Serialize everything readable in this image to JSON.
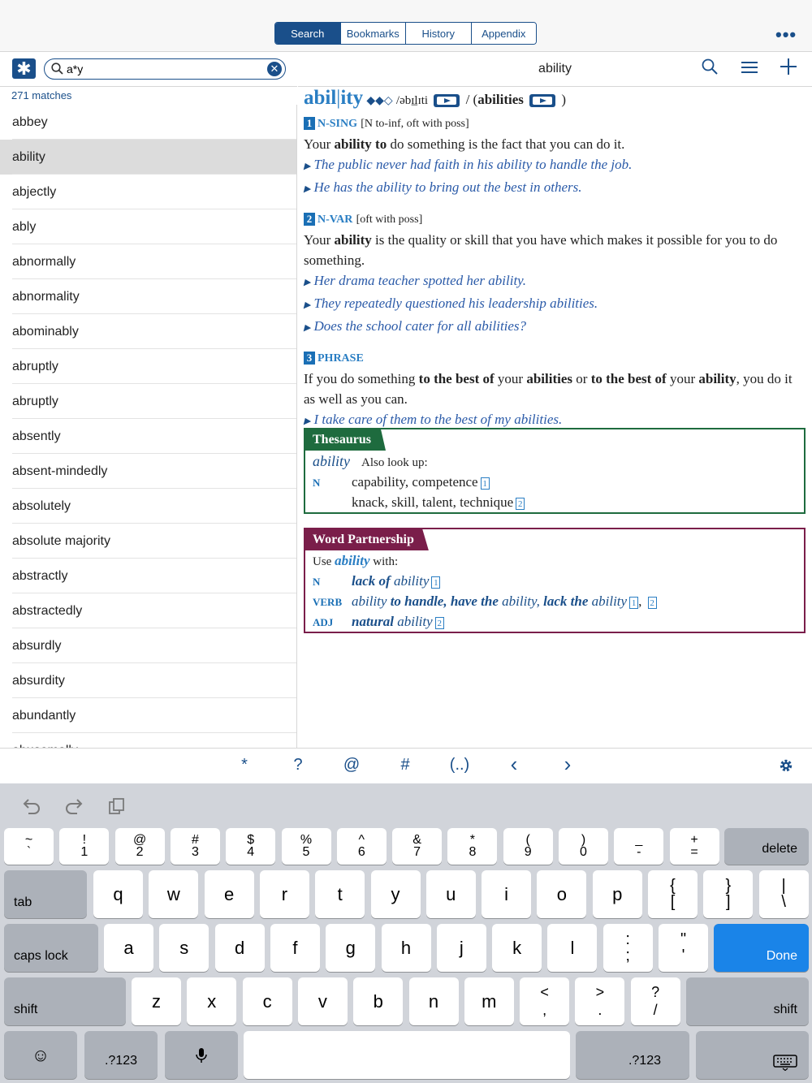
{
  "header": {
    "tabs": [
      "Search",
      "Bookmarks",
      "History",
      "Appendix"
    ],
    "active_tab": "Search",
    "more_icon": "ellipsis-icon"
  },
  "search": {
    "query": "a*y",
    "wildcard_icon": "asterisk-icon",
    "matches": "271 matches",
    "results": [
      "abbey",
      "ability",
      "abjectly",
      "ably",
      "abnormally",
      "abnormality",
      "abominably",
      "abruptly",
      "abruptly",
      "absently",
      "absent-mindedly",
      "absolutely",
      "absolute majority",
      "abstractly",
      "abstractedly",
      "absurdly",
      "absurdity",
      "abundantly",
      "abusemally"
    ],
    "selected": "ability"
  },
  "entry_header": {
    "title": "ability",
    "icons": [
      "search-icon",
      "list-icon",
      "add-icon"
    ]
  },
  "entry": {
    "headword_a": "abil",
    "headword_b": "ity",
    "frequency": "◆◆◇",
    "pron": "/əbɪ̲lɪti",
    "plural_sep": "/ (",
    "plural": "abilities",
    "plural_end": ")",
    "senses": [
      {
        "num": "1",
        "pos": "N-SING",
        "gram": "[N to-inf, oft with poss]",
        "def_a": "Your ",
        "def_b": "ability to",
        "def_c": " do something is the fact that you can do it.",
        "examples": [
          "The public never had faith in his ability to handle the job.",
          "He has the ability to bring out the best in others."
        ]
      },
      {
        "num": "2",
        "pos": "N-VAR",
        "gram": "[oft with poss]",
        "def_a": "Your ",
        "def_b": "ability",
        "def_c": " is the quality or skill that you have which makes it possible for you to do something.",
        "examples": [
          "Her drama teacher spotted her ability.",
          "They repeatedly questioned his leadership abilities.",
          "Does the school cater for all abilities?"
        ]
      },
      {
        "num": "3",
        "pos": "PHRASE",
        "def_1": "If you do something ",
        "def_2": "to the best of",
        "def_3": " your ",
        "def_4": "abilities",
        "def_5": " or ",
        "def_6": "to the best of",
        "def_7": " your ",
        "def_8": "ability",
        "def_9": ", you do it as well as you can.",
        "examples": [
          "I take care of them to the best of my abilities."
        ]
      }
    ],
    "thesaurus": {
      "title": "Thesaurus",
      "word": "ability",
      "also": "Also look up:",
      "pos": "N",
      "line1": "capability, competence",
      "ref1": "1",
      "line2": "knack, skill, talent, technique",
      "ref2": "2"
    },
    "partnership": {
      "title": "Word Partnership",
      "use_a": "Use ",
      "use_word": "ability",
      "use_b": " with:",
      "rows": [
        {
          "pos": "N",
          "p1": "lack of",
          "p2": " ability",
          "refs": "1"
        },
        {
          "pos": "VERB",
          "p1": "ability",
          "p2": " to handle, have the",
          "p3": " ability, ",
          "p4": "lack the",
          "p5": " ability",
          "refs": [
            "1",
            "2"
          ]
        },
        {
          "pos": "ADJ",
          "p1": "natural",
          "p2": " ability",
          "refs": "2"
        }
      ]
    }
  },
  "accessory_bar": [
    "*",
    "?",
    "@",
    "#",
    "(..)",
    "‹",
    "›"
  ],
  "keyboard": {
    "row1": [
      [
        "~",
        "`"
      ],
      [
        "!",
        "1"
      ],
      [
        "@",
        "2"
      ],
      [
        "#",
        "3"
      ],
      [
        "$",
        "4"
      ],
      [
        "%",
        "5"
      ],
      [
        "^",
        "6"
      ],
      [
        "&",
        "7"
      ],
      [
        "*",
        "8"
      ],
      [
        "(",
        "9"
      ],
      [
        ")",
        "0"
      ],
      [
        "_",
        "-"
      ],
      [
        "+",
        "="
      ]
    ],
    "delete": "delete",
    "row2": [
      "q",
      "w",
      "e",
      "r",
      "t",
      "y",
      "u",
      "i",
      "o",
      "p"
    ],
    "row2_extra": [
      [
        "{",
        "["
      ],
      [
        "}",
        "]"
      ],
      [
        "|",
        "\\"
      ]
    ],
    "tab": "tab",
    "row3": [
      "a",
      "s",
      "d",
      "f",
      "g",
      "h",
      "j",
      "k",
      "l"
    ],
    "row3_extra": [
      [
        ":",
        ";"
      ],
      [
        "\"",
        "'"
      ]
    ],
    "caps": "caps lock",
    "done": "Done",
    "row4": [
      "z",
      "x",
      "c",
      "v",
      "b",
      "n",
      "m"
    ],
    "row4_extra": [
      [
        "<",
        ","
      ],
      [
        ">",
        "."
      ],
      [
        "?",
        "/"
      ]
    ],
    "shift": "shift",
    "num": ".?123"
  }
}
